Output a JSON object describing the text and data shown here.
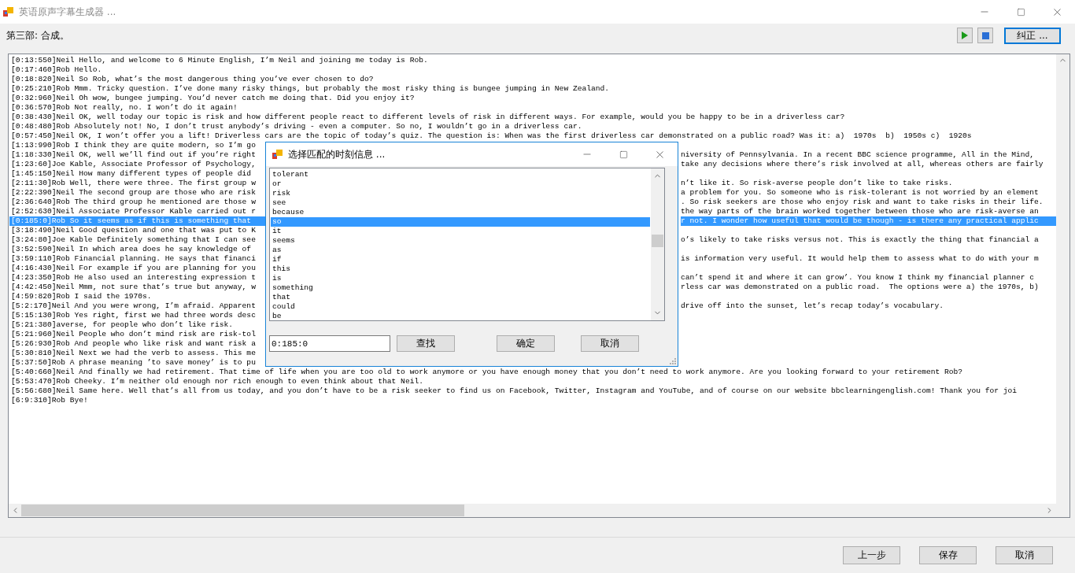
{
  "window": {
    "title": "英语原声字幕生成器 ..."
  },
  "toolbar": {
    "step_label": "第三部: 合成。",
    "correct_button": "纠正 ..."
  },
  "transcript": {
    "lines": [
      {
        "kind": "full",
        "text": "[0:13:550]Neil Hello, and welcome to 6 Minute English, I’m Neil and joining me today is Rob.",
        "selected": false
      },
      {
        "kind": "full",
        "text": "[0:17:460]Rob Hello.",
        "selected": false
      },
      {
        "kind": "full",
        "text": "[0:18:820]Neil So Rob, what’s the most dangerous thing you’ve ever chosen to do?",
        "selected": false
      },
      {
        "kind": "full",
        "text": "[0:25:210]Rob Mmm. Tricky question. I’ve done many risky things, but probably the most risky thing is bungee jumping in New Zealand.",
        "selected": false
      },
      {
        "kind": "full",
        "text": "[0:32:960]Neil Oh wow, bungee jumping. You’d never catch me doing that. Did you enjoy it?",
        "selected": false
      },
      {
        "kind": "full",
        "text": "[0:36:570]Rob Not really, no. I won’t do it again!",
        "selected": false
      },
      {
        "kind": "full",
        "text": "[0:38:430]Neil OK, well today our topic is risk and how different people react to different levels of risk in different ways. For example, would you be happy to be in a driverless car?",
        "selected": false
      },
      {
        "kind": "full",
        "text": "[0:48:480]Rob Absolutely not! No, I don’t trust anybody’s driving - even a computer. So no, I wouldn’t go in a driverless car.",
        "selected": false
      },
      {
        "kind": "full",
        "text": "[0:57:450]Neil OK, I won’t offer you a lift! Driverless cars are the topic of today’s quiz. The question is: When was the first driverless car demonstrated on a public road? Was it: a)  1970s  b)  1950s c)  1920s",
        "selected": false
      },
      {
        "kind": "split",
        "left": "[1:13:990]Rob I think they are quite modern, so I’m go",
        "selected": false
      },
      {
        "kind": "split",
        "left": "[1:18:330]Neil OK, well we’ll find out if you’re right",
        "right": "niversity of Pennsylvania. In a recent BBC science programme, All in the Mind,",
        "selected": false
      },
      {
        "kind": "split",
        "left": "[1:23:60]Joe Kable, Associate Professor of Psychology,",
        "right": "take any decisions where there’s risk involved at all, whereas others are fairly",
        "selected": false
      },
      {
        "kind": "split",
        "left": "[1:45:150]Neil How many different types of people did",
        "selected": false
      },
      {
        "kind": "split",
        "left": "[2:11:30]Rob Well, there were three. The first group w",
        "right": "n’t like it. So risk-averse people don’t like to take risks.",
        "selected": false
      },
      {
        "kind": "split",
        "left": "[2:22:390]Neil The second group are those who are risk",
        "right": "a problem for you. So someone who is risk-tolerant is not worried by an element",
        "selected": false
      },
      {
        "kind": "split",
        "left": "[2:36:640]Rob The third group he mentioned are those w",
        "right": ". So risk seekers are those who enjoy risk and want to take risks in their life.",
        "selected": false
      },
      {
        "kind": "split",
        "left": "[2:52:630]Neil Associate Professor Kable carried out r",
        "right": "the way parts of the brain worked together between those who are risk-averse an",
        "selected": false
      },
      {
        "kind": "split",
        "left": "[0:185:0]Rob So it seems as if this is something that",
        "right": "r not. I wonder how useful that would be though - is there any practical applic",
        "selected": true
      },
      {
        "kind": "split",
        "left": "[3:18:490]Neil Good question and one that was put to K",
        "selected": false
      },
      {
        "kind": "split",
        "left": "[3:24:80]Joe Kable Definitely something that I can see",
        "right": "o’s likely to take risks versus not. This is exactly the thing that financial a",
        "selected": false
      },
      {
        "kind": "split",
        "left": "[3:52:590]Neil In which area does he say knowledge of",
        "selected": false
      },
      {
        "kind": "split",
        "left": "[3:59:110]Rob Financial planning. He says that financi",
        "right": "is information very useful. It would help them to assess what to do with your m",
        "selected": false
      },
      {
        "kind": "split",
        "left": "[4:16:430]Neil For example if you are planning for you",
        "selected": false
      },
      {
        "kind": "split",
        "left": "[4:23:350]Rob He also used an interesting expression t",
        "right": "can’t spend it and where it can grow’. You know I think my financial planner c",
        "selected": false
      },
      {
        "kind": "split",
        "left": "[4:42:450]Neil Mmm, not sure that’s true but anyway, w",
        "right": "rless car was demonstrated on a public road.  The options were a) the 1970s, b)",
        "selected": false
      },
      {
        "kind": "split",
        "left": "[4:59:820]Rob I said the 1970s.",
        "selected": false
      },
      {
        "kind": "split",
        "left": "[5:2:170]Neil And you were wrong, I’m afraid. Apparent",
        "right": "drive off into the sunset, let’s recap today’s vocabulary.",
        "selected": false
      },
      {
        "kind": "split",
        "left": "[5:15:130]Rob Yes right, first we had three words desc",
        "selected": false
      },
      {
        "kind": "split",
        "left": "[5:21:380]averse, for people who don’t like risk.",
        "selected": false
      },
      {
        "kind": "split",
        "left": "[5:21:960]Neil People who don’t mind risk are risk-tol",
        "selected": false
      },
      {
        "kind": "split",
        "left": "[5:26:930]Rob And people who like risk and want risk a",
        "selected": false
      },
      {
        "kind": "split",
        "left": "[5:30:810]Neil Next we had the verb to assess. This me",
        "selected": false
      },
      {
        "kind": "split",
        "left": "[5:37:50]Rob A phrase meaning ’to save money’ is to pu",
        "selected": false
      },
      {
        "kind": "full",
        "text": "[5:40:660]Neil And finally we had retirement. That time of life when you are too old to work anymore or you have enough money that you don’t need to work anymore. Are you looking forward to your retirement Rob?",
        "selected": false
      },
      {
        "kind": "full",
        "text": "[5:53:470]Rob Cheeky. I’m neither old enough nor rich enough to even think about that Neil.",
        "selected": false
      },
      {
        "kind": "full",
        "text": "[5:56:680]Neil Same here. Well that’s all from us today, and you don’t have to be a risk seeker to find us on Facebook, Twitter, Instagram and YouTube, and of course on our website bbclearningenglish.com! Thank you for joi",
        "selected": false
      },
      {
        "kind": "full",
        "text": "[6:9:310]Rob Bye!",
        "selected": false
      }
    ]
  },
  "dialog": {
    "title": "选择匹配的时刻信息 ...",
    "words": [
      {
        "text": "tolerant",
        "selected": false
      },
      {
        "text": "or",
        "selected": false
      },
      {
        "text": "risk",
        "selected": false
      },
      {
        "text": "see",
        "selected": false
      },
      {
        "text": "because",
        "selected": false
      },
      {
        "text": "so",
        "selected": true
      },
      {
        "text": "it",
        "selected": false
      },
      {
        "text": "seems",
        "selected": false
      },
      {
        "text": "as",
        "selected": false
      },
      {
        "text": "if",
        "selected": false
      },
      {
        "text": "this",
        "selected": false
      },
      {
        "text": "is",
        "selected": false
      },
      {
        "text": "something",
        "selected": false
      },
      {
        "text": "that",
        "selected": false
      },
      {
        "text": "could",
        "selected": false
      },
      {
        "text": "be",
        "selected": false
      }
    ],
    "time_field": {
      "value": "0:185:0"
    },
    "search_button": "查找",
    "ok_button": "确定",
    "cancel_button": "取消"
  },
  "footer": {
    "buttons": [
      "上一步",
      "保存",
      "取消"
    ]
  }
}
